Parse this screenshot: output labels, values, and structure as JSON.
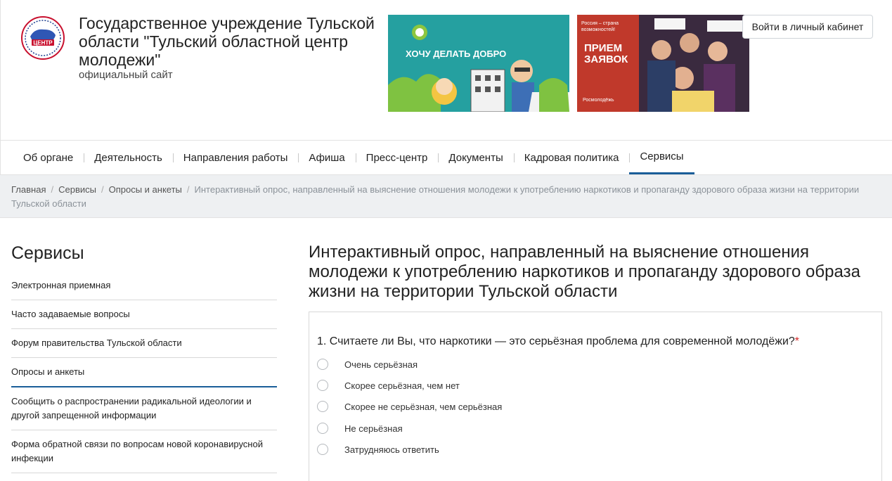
{
  "header": {
    "org_title": "Государственное учреждение Тульской области \"Тульский областной центр молодежи\"",
    "org_subtitle": "официальный сайт",
    "logo_text": "ЦЕНТР",
    "banner1_text": "ХОЧУ ДЕЛАТЬ ДОБРО",
    "banner2_tag": "Россия – страна возможностей!",
    "banner2_title": "ПРИЕМ ЗАЯВОК",
    "banner2_footer": "Росмолодёжь",
    "login_button": "Войти в личный кабинет"
  },
  "nav": {
    "items": [
      "Об органе",
      "Деятельность",
      "Направления работы",
      "Афиша",
      "Пресс-центр",
      "Документы",
      "Кадровая политика",
      "Сервисы"
    ],
    "active_index": 7
  },
  "breadcrumb": {
    "items": [
      "Главная",
      "Сервисы",
      "Опросы и анкеты"
    ],
    "current": "Интерактивный опрос, направленный на выяснение отношения молодежи к употреблению наркотиков и пропаганду здорового образа жизни на территории Тульской области"
  },
  "sidebar": {
    "title": "Сервисы",
    "items": [
      "Электронная приемная",
      "Часто задаваемые вопросы",
      "Форум правительства Тульской области",
      "Опросы и анкеты",
      "Сообщить о распространении радикальной идеологии и другой запрещенной информации",
      "Форма обратной связи по вопросам новой коронавирусной инфекции"
    ],
    "active_index": 3
  },
  "main": {
    "title": "Интерактивный опрос, направленный на выяснение отношения молодежи к употреблению наркотиков и пропаганду здорового образа жизни на территории Тульской области",
    "question": "1. Считаете ли Вы, что наркотики — это серьёзная проблема для современной молодёжи?",
    "required_mark": "*",
    "options": [
      "Очень серьёзная",
      "Скорее серьёзная, чем нет",
      "Скорее не серьёзная, чем серьёзная",
      "Не серьёзная",
      "Затрудняюсь ответить"
    ]
  },
  "colors": {
    "accent": "#1a5e99",
    "required": "#d62828",
    "breadcrumb_bg": "#eef0f2"
  }
}
